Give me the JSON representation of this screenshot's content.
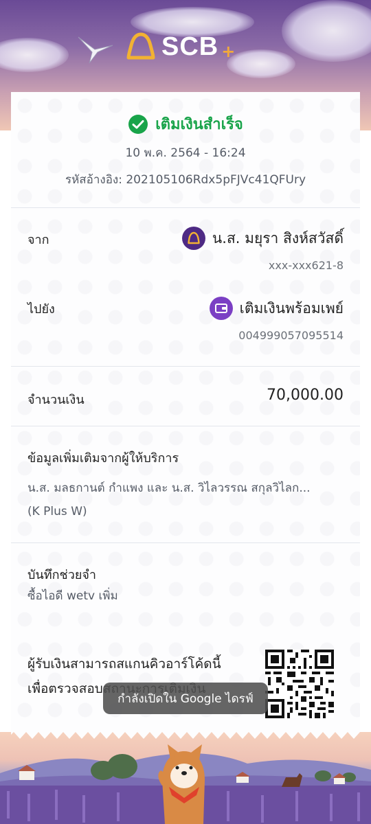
{
  "brand": {
    "name": "SCB",
    "plus": "+"
  },
  "status": {
    "title": "เติมเงินสำเร็จ"
  },
  "transaction": {
    "datetime": "10 พ.ค. 2564 - 16:24",
    "reference": "รหัสอ้างอิง: 202105106Rdx5pFJVc41QFUry"
  },
  "from": {
    "label": "จาก",
    "name": "น.ส. มยุรา สิงห์สวัสดิ์",
    "account": "xxx-xxx621-8"
  },
  "to": {
    "label": "ไปยัง",
    "name": "เติมเงินพร้อมเพย์",
    "account": "004999057095514"
  },
  "amount": {
    "label": "จำนวนเงิน",
    "value": "70,000.00"
  },
  "provider_info": {
    "label": "ข้อมูลเพิ่มเติมจากผู้ให้บริการ",
    "line1": "น.ส. มลธกานต์ กำแพง และ น.ส. วิไลวรรณ สกุลวิไลก...",
    "line2": "(K Plus W)"
  },
  "memo": {
    "label": "บันทึกช่วยจำ",
    "text": "ซื้อไอดี wetv เพิ่ม"
  },
  "qr_section": {
    "line1": "ผู้รับเงินสามารถสแกนคิวอาร์โค้ดนี้",
    "line2": "เพื่อตรวจสอบสถานะการเติมเงิน"
  },
  "toast": {
    "text": "กำลังเปิดใน Google ไดรฟ์"
  },
  "colors": {
    "accent_purple": "#4e2a84",
    "success_green": "#19a44a",
    "promptpay_purple": "#7b3fc4"
  },
  "icons": {
    "success": "check-circle-icon",
    "scb": "scb-logo-icon",
    "wallet": "wallet-icon",
    "qr": "qr-code"
  }
}
